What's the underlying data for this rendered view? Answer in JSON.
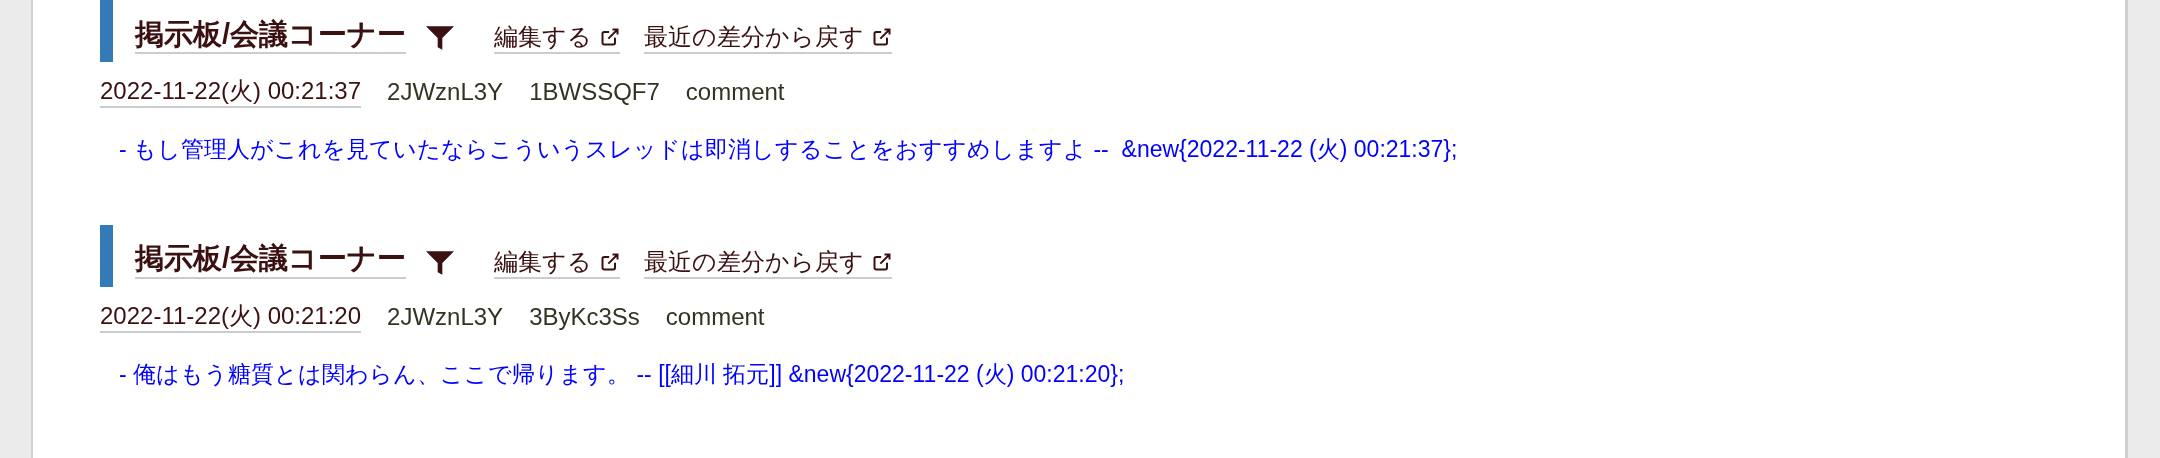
{
  "entries": [
    {
      "title": "掲示板/会議コーナー",
      "edit_link": "編集する",
      "diff_link": "最近の差分から戻す",
      "date": "2022-11-22(火) 00:21:37",
      "author_id": "2JWznL3Y",
      "post_id": "1BWSSQF7",
      "type": "comment",
      "comment": "- もし管理人がこれを見ていたならこういうスレッドは即消しすることをおすすめしますよ --  &new{2022-11-22 (火) 00:21:37};"
    },
    {
      "title": "掲示板/会議コーナー",
      "edit_link": "編集する",
      "diff_link": "最近の差分から戻す",
      "date": "2022-11-22(火) 00:21:20",
      "author_id": "2JWznL3Y",
      "post_id": "3ByKc3Ss",
      "type": "comment",
      "comment": "- 俺はもう糖質とは関わらん、ここで帰ります。 -- [[細川 拓元]] &new{2022-11-22 (火) 00:21:20};"
    }
  ]
}
